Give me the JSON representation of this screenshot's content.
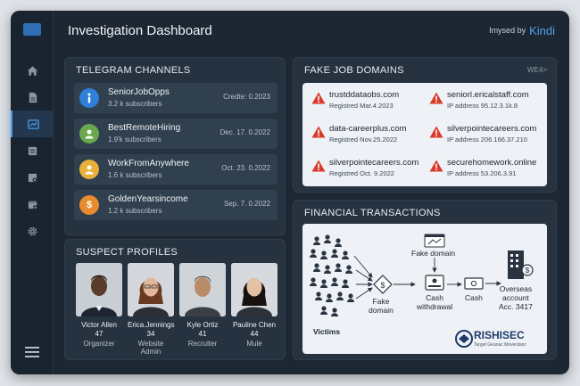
{
  "header": {
    "title": "Investigation Dashboard",
    "brand_prefix": "Imysed by",
    "brand_name": "Kindi"
  },
  "sidebar": {
    "items": [
      {
        "icon": "home-icon"
      },
      {
        "icon": "document-icon"
      },
      {
        "icon": "chart-icon",
        "active": true
      },
      {
        "icon": "list-icon"
      },
      {
        "icon": "report-icon"
      },
      {
        "icon": "calendar-icon"
      },
      {
        "icon": "settings-icon"
      }
    ]
  },
  "telegram": {
    "title": "TELEGRAM CHANNELS",
    "channels": [
      {
        "name": "SeniorJobOpps",
        "subs": "3.2 k subscribers",
        "date": "Credte: 0.2023",
        "color": "#2f80d8",
        "icon": "info-icon"
      },
      {
        "name": "BestRemoteHiring",
        "subs": "1.9'k subscribers",
        "date": "Dec. 17. 0.2022",
        "color": "#6aa84f",
        "icon": "user-icon"
      },
      {
        "name": "WorkFromAnywhere",
        "subs": "1.6 k subscribers",
        "date": "Oct. 23. 0.2022",
        "color": "#e8b23a",
        "icon": "user-icon"
      },
      {
        "name": "GoldenYearsincome",
        "subs": "1.2 k subscribers",
        "date": "Sep. 7. 0.2022",
        "color": "#e88a2e",
        "icon": "dollar-icon"
      }
    ]
  },
  "profiles": {
    "title": "SUSPECT PROFILES",
    "people": [
      {
        "name": "Victor Allen",
        "age": "47",
        "role": "Organizer"
      },
      {
        "name": "Erica.Jennings",
        "age": "34",
        "role": "Website Admin"
      },
      {
        "name": "Kyle Ortiz",
        "age": "41",
        "role": "Recrulter"
      },
      {
        "name": "Pauline Chen",
        "age": "44",
        "role": "Mule"
      }
    ]
  },
  "domains": {
    "title": "FAKE JOB DOMAINS",
    "badge": "WE4>",
    "items": [
      {
        "name": "trustddataobs.com",
        "info": "Registred Mar.4.2023"
      },
      {
        "name": "seniorl.ericalstaff.com",
        "info": "IP address 95.12.3.1k.8"
      },
      {
        "name": "data-careerplus.com",
        "info": "Registred Nov.25.2022"
      },
      {
        "name": "silverpointecareers.com",
        "info": "IP address 206.166.37.210"
      },
      {
        "name": "silverpointecareers.com",
        "info": "Registred Oct. 9.2022"
      },
      {
        "name": "securehomework.online",
        "info": "IP address 53.206.3.91"
      }
    ]
  },
  "finance": {
    "title": "FINANCIAL TRANSACTIONS",
    "victims": "Victims",
    "fake_domain_top": "Fake domain",
    "fake_domain_mid": "Fake\ndomain",
    "cash_withdrawal": "Cash\nwithdrawal",
    "cash": "Cash",
    "overseas": "Overseas\naccount\nAcc. 3417",
    "brand": "RISHISEC",
    "brand_tag": "Target Geanac Moverdanc"
  }
}
